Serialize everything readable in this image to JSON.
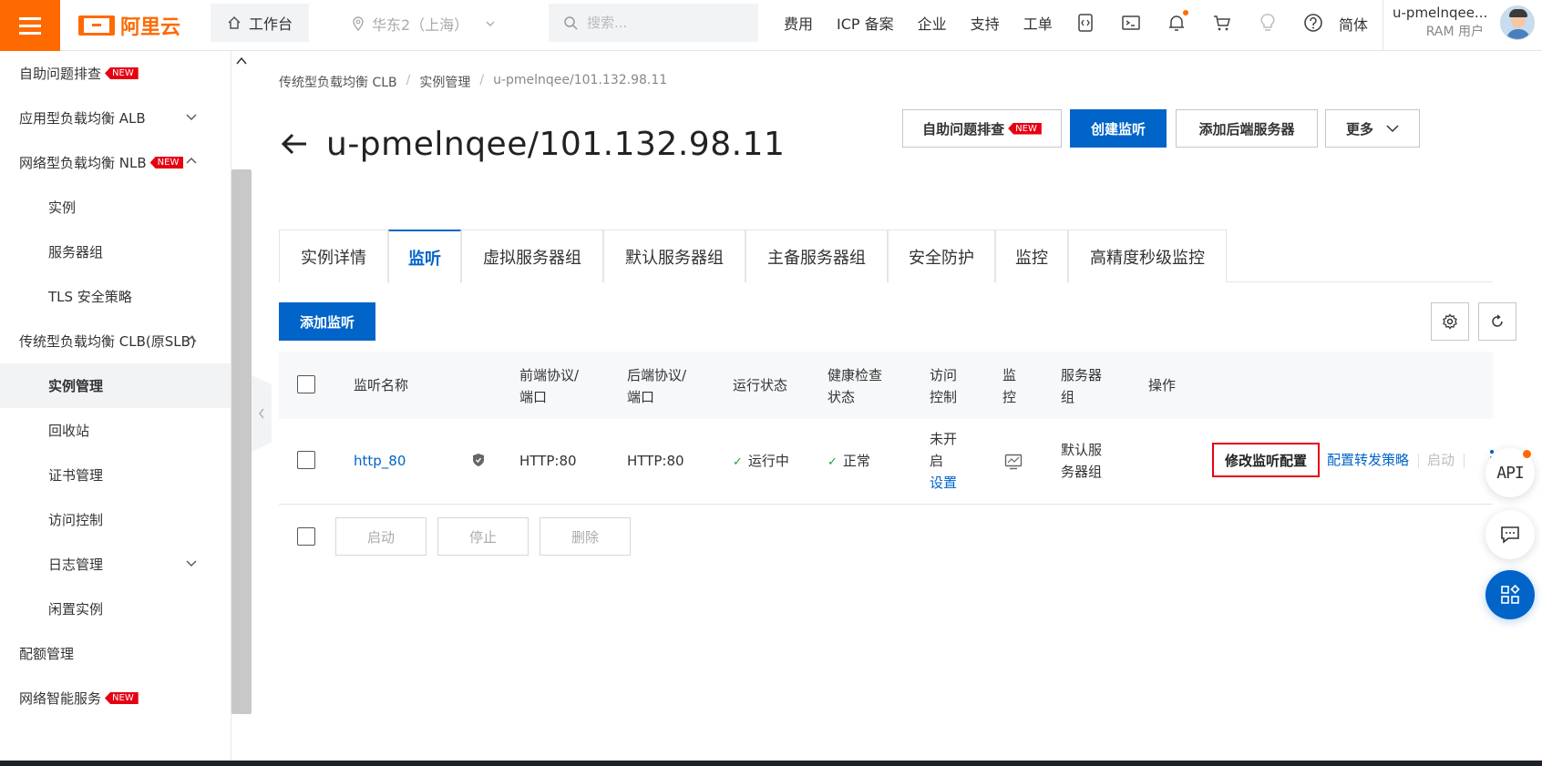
{
  "topbar": {
    "logo_text": "阿里云",
    "workbench_label": "工作台",
    "region_label": "华东2（上海）",
    "search_placeholder": "搜索...",
    "nav": [
      "费用",
      "ICP 备案",
      "企业",
      "支持",
      "工单"
    ],
    "icons": [
      "code-icon",
      "terminal-icon",
      "bell-icon",
      "cart-icon",
      "lightbulb-icon",
      "help-icon"
    ],
    "lang_label": "简体",
    "user_name": "u-pmelnqee...",
    "user_role": "RAM 用户",
    "accent_color": "#ff6a00"
  },
  "sidebar": {
    "items": [
      {
        "label": "自助问题排查",
        "badge": "NEW"
      },
      {
        "label": "应用型负载均衡 ALB",
        "caret": "down"
      },
      {
        "label": "网络型负载均衡 NLB",
        "badge": "NEW",
        "caret": "up"
      },
      {
        "label": "实例"
      },
      {
        "label": "服务器组"
      },
      {
        "label": "TLS 安全策略"
      },
      {
        "label": "传统型负载均衡 CLB(原SLB)",
        "caret": "up"
      },
      {
        "label": "实例管理",
        "active": true
      },
      {
        "label": "回收站"
      },
      {
        "label": "证书管理"
      },
      {
        "label": "访问控制"
      },
      {
        "label": "日志管理",
        "caret": "down"
      },
      {
        "label": "闲置实例"
      },
      {
        "label": "配额管理"
      },
      {
        "label": "网络智能服务",
        "badge": "NEW"
      }
    ]
  },
  "breadcrumb": [
    "传统型负载均衡 CLB",
    "实例管理",
    "u-pmelnqee/101.132.98.11"
  ],
  "page_title": "u-pmelnqee/101.132.98.11",
  "header_buttons": {
    "troubleshoot": "自助问题排查",
    "troubleshoot_badge": "NEW",
    "create_listener": "创建监听",
    "add_backend": "添加后端服务器",
    "more": "更多"
  },
  "tabs": [
    "实例详情",
    "监听",
    "虚拟服务器组",
    "默认服务器组",
    "主备服务器组",
    "安全防护",
    "监控",
    "高精度秒级监控"
  ],
  "active_tab": "监听",
  "add_listener_label": "添加监听",
  "table": {
    "headers": {
      "name": "监听名称",
      "frontend_1": "前端协议/",
      "frontend_2": "端口",
      "backend_1": "后端协议/",
      "backend_2": "端口",
      "status": "运行状态",
      "health_1": "健康检查",
      "health_2": "状态",
      "acl_1": "访问",
      "acl_2": "控制",
      "monitor_1": "监",
      "monitor_2": "控",
      "group_1": "服务器",
      "group_2": "组",
      "actions": "操作"
    },
    "rows": [
      {
        "name": "http_80",
        "frontend": "HTTP:80",
        "backend": "HTTP:80",
        "status": "运行中",
        "health": "正常",
        "acl_line1": "未开",
        "acl_line2": "启",
        "acl_link": "设置",
        "group_line1": "默认服",
        "group_line2": "务器组",
        "action_edit": "修改监听配置",
        "action_forward": "配置转发策略",
        "action_start": "启动"
      }
    ]
  },
  "batch_buttons": {
    "start": "启动",
    "stop": "停止",
    "delete": "删除"
  },
  "float_tools": {
    "api_label": "API"
  },
  "colors": {
    "primary": "#0064c8",
    "danger": "#e60012",
    "success": "#1fa33a"
  }
}
